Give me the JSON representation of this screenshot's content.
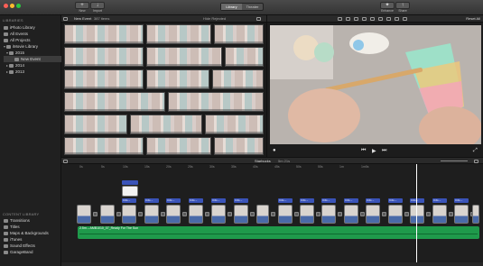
{
  "toolbar": {
    "new_label": "New",
    "import_label": "Import",
    "tabs": [
      {
        "label": "Library",
        "active": true
      },
      {
        "label": "Theater",
        "active": false
      }
    ],
    "enhance_label": "Enhance",
    "share_label": "Share"
  },
  "sidebar": {
    "libraries_header": "LIBRARIES",
    "items": [
      {
        "label": "iPhoto Library",
        "icon": "photo-library-icon"
      },
      {
        "label": "All Events",
        "icon": "events-icon"
      },
      {
        "label": "All Projects",
        "icon": "projects-icon"
      },
      {
        "label": "iMovie Library",
        "icon": "movie-library-icon"
      },
      {
        "label": "2015",
        "icon": "folder-icon"
      },
      {
        "label": "New Event",
        "icon": "event-icon",
        "selected": true
      },
      {
        "label": "2014",
        "icon": "folder-icon"
      },
      {
        "label": "2013",
        "icon": "folder-icon"
      }
    ],
    "content_header": "CONTENT LIBRARY",
    "content_items": [
      {
        "label": "Transitions",
        "icon": "transitions-icon"
      },
      {
        "label": "Titles",
        "icon": "titles-icon"
      },
      {
        "label": "Maps & Backgrounds",
        "icon": "maps-icon"
      },
      {
        "label": "iTunes",
        "icon": "itunes-icon"
      },
      {
        "label": "Sound Effects",
        "icon": "sound-effects-icon"
      },
      {
        "label": "GarageBand",
        "icon": "garageband-icon"
      }
    ]
  },
  "browser": {
    "event_title": "New Event",
    "item_count": "387 items",
    "filter_label": "Hide Rejected"
  },
  "viewer": {
    "reset_all": "Reset All"
  },
  "timeline": {
    "project_name": "Starbucks",
    "duration": "5m 21s",
    "ticks": [
      "0s",
      "5s",
      "10s",
      "15s",
      "20s",
      "25s",
      "30s",
      "35s",
      "40s",
      "45s",
      "50s",
      "55s",
      "1m",
      "1m5s"
    ],
    "clip_label_short": "3.0s –",
    "music_label": "2.5m – AMB1010_07_Ready For The Sun"
  },
  "colors": {
    "clip_label_blue": "#3a53b8",
    "music_green": "#1f9a4b"
  }
}
